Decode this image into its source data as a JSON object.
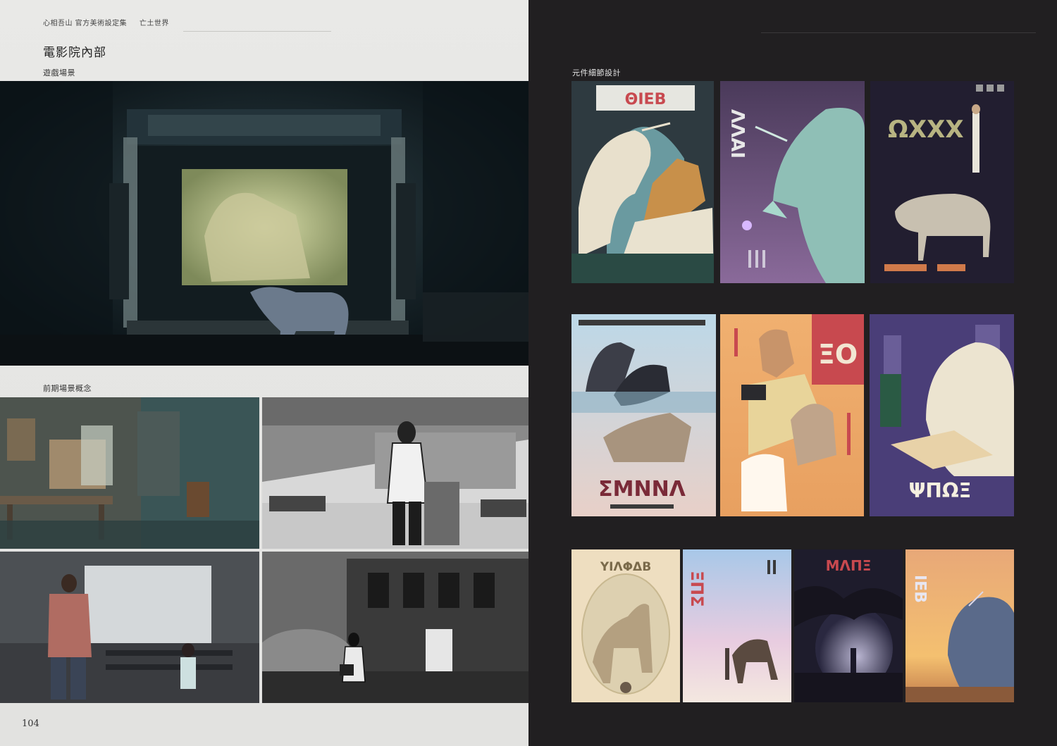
{
  "left_page": {
    "running_head": {
      "book_title": "心相吾山 官方美術設定集",
      "chapter": "亡土世界"
    },
    "title": "電影院內部",
    "section_game_scene": "遊戲場景",
    "section_concept": "前期場景概念",
    "page_number": "104"
  },
  "right_page": {
    "section_label": "元件細節設計"
  },
  "poster_glyphs": {
    "p1": "ΘΙΕΒ",
    "p2": "ΛΛΑΙ",
    "p3": "ΩΧΧΧ",
    "p4": "ΣΜΝΝΛ",
    "p5": "ΞΟ",
    "p6": "ΨΠΩΞ",
    "p7": "ΥΙΛΦΔΒ",
    "p8": "ΞΠΣ",
    "p9": "ΜΛΠΞ",
    "p10": "ΙΕΒ"
  },
  "colors": {
    "left_paper": "#e6e6e4",
    "right_dark": "#211f21",
    "poster_red": "#c8494f"
  }
}
